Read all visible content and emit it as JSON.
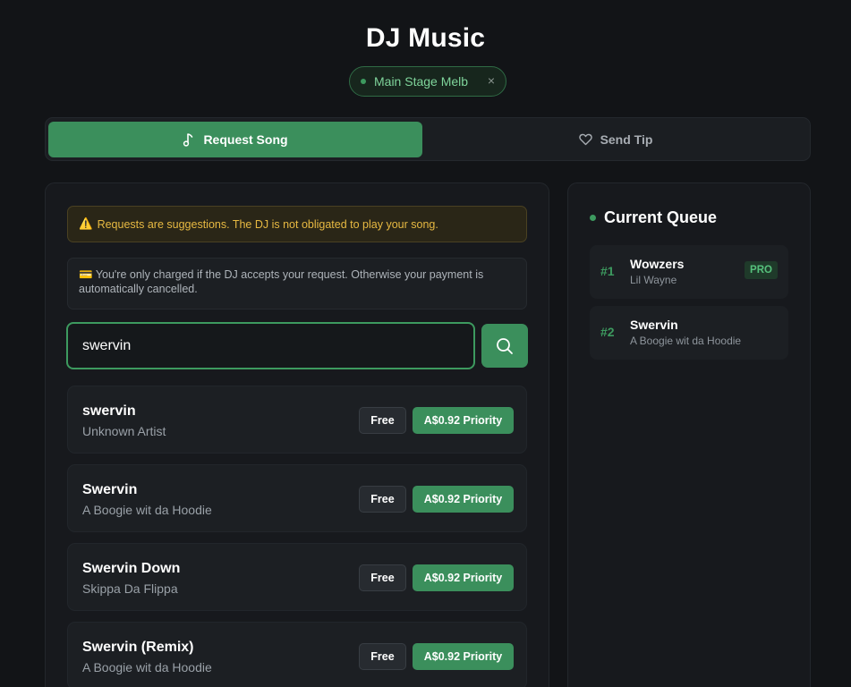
{
  "app": {
    "title": "DJ Music",
    "venue": "Main Stage Melb",
    "venue_close": "×"
  },
  "tabs": [
    {
      "label": "Request Song",
      "icon": "music-note-icon",
      "active": true
    },
    {
      "label": "Send Tip",
      "icon": "heart-icon",
      "active": false
    }
  ],
  "notices": {
    "warning_icon": "⚠️",
    "warning": "Requests are suggestions. The DJ is not obligated to play your song.",
    "info_icon": "💳",
    "info": "You're only charged if the DJ accepts your request. Otherwise your payment is automatically cancelled."
  },
  "search": {
    "value": "swervin",
    "button_icon": "search-icon"
  },
  "results": [
    {
      "song": "swervin",
      "artist": "Unknown Artist",
      "free_label": "Free",
      "priority_label": "A$0.92 Priority"
    },
    {
      "song": "Swervin",
      "artist": "A Boogie wit da Hoodie",
      "free_label": "Free",
      "priority_label": "A$0.92 Priority"
    },
    {
      "song": "Swervin Down",
      "artist": "Skippa Da Flippa",
      "free_label": "Free",
      "priority_label": "A$0.92 Priority"
    },
    {
      "song": "Swervin (Remix)",
      "artist": "A Boogie wit da Hoodie",
      "free_label": "Free",
      "priority_label": "A$0.92 Priority"
    }
  ],
  "queue": {
    "title": "Current Queue",
    "items": [
      {
        "position": "#1",
        "song": "Wowzers",
        "artist": "Lil Wayne",
        "badge": "PRO"
      },
      {
        "position": "#2",
        "song": "Swervin",
        "artist": "A Boogie wit da Hoodie",
        "badge": ""
      }
    ]
  },
  "colors": {
    "accent": "#3b8f5c",
    "background": "#121417",
    "warning": "#e7b942"
  }
}
